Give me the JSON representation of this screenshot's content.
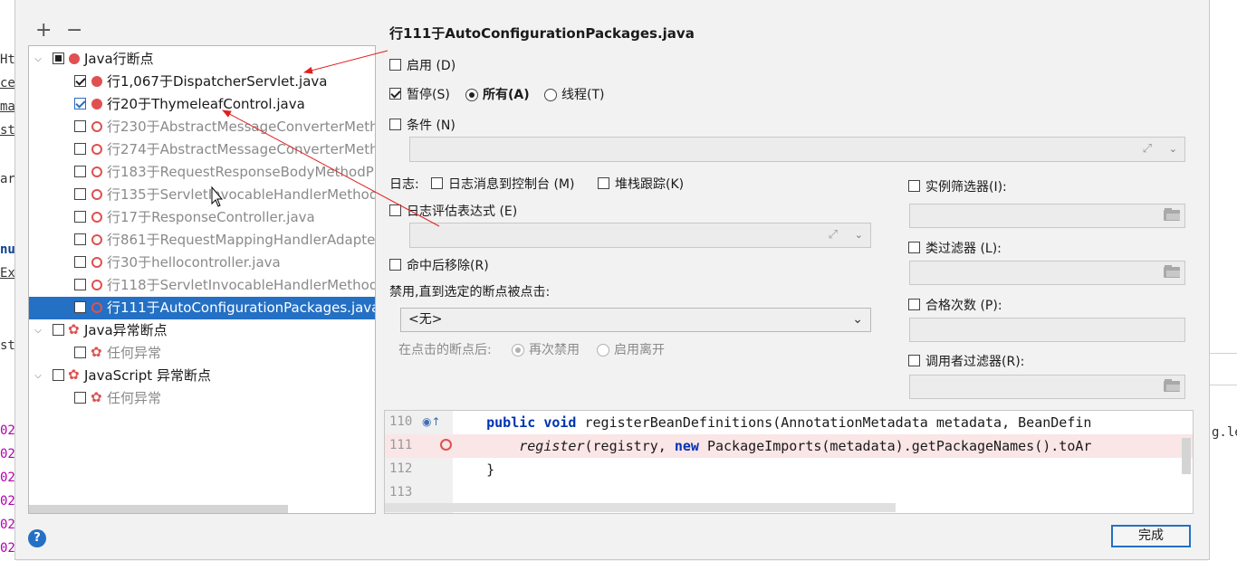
{
  "background": {
    "left_glyphs": [
      "Ht",
      "ce",
      "ma",
      "st",
      "ar",
      "nu",
      "Ex",
      "st",
      "02",
      "02",
      "02",
      "02",
      "02",
      "02",
      "02"
    ],
    "right_text": "g.le"
  },
  "toolbar": {
    "add_label": "+",
    "remove_label": "−"
  },
  "tree": {
    "groups": [
      {
        "label": "Java行断点",
        "items": [
          {
            "label": "行1,067于DispatcherServlet.java",
            "checked": true,
            "enabled": true
          },
          {
            "label": "行20于ThymeleafControl.java",
            "checked": true,
            "enabled": true
          },
          {
            "label": "行230于AbstractMessageConverterMeth",
            "checked": false,
            "enabled": false
          },
          {
            "label": "行274于AbstractMessageConverterMeth",
            "checked": false,
            "enabled": false
          },
          {
            "label": "行183于RequestResponseBodyMethodP",
            "checked": false,
            "enabled": false
          },
          {
            "label": "行135于ServletInvocableHandlerMethod",
            "checked": false,
            "enabled": false
          },
          {
            "label": "行17于ResponseController.java",
            "checked": false,
            "enabled": false
          },
          {
            "label": "行861于RequestMappingHandlerAdapte",
            "checked": false,
            "enabled": false
          },
          {
            "label": "行30于hellocontroller.java",
            "checked": false,
            "enabled": false
          },
          {
            "label": "行118于ServletInvocableHandlerMethod",
            "checked": false,
            "enabled": false
          },
          {
            "label": "行111于AutoConfigurationPackages.java",
            "checked": false,
            "enabled": false,
            "selected": true
          }
        ]
      },
      {
        "label": "Java异常断点",
        "items": [
          {
            "label": "任何异常"
          }
        ]
      },
      {
        "label": "JavaScript 异常断点",
        "items": [
          {
            "label": "任何异常"
          }
        ]
      }
    ]
  },
  "detail": {
    "title": "行111于AutoConfigurationPackages.java",
    "enabled_label": "启用 (D)",
    "suspend_label": "暂停(S)",
    "all_label": "所有(A)",
    "thread_label": "线程(T)",
    "condition_label": "条件 (N)",
    "log_label": "日志:",
    "log_message_label": "日志消息到控制台 (M)",
    "stack_trace_label": "堆栈跟踪(K)",
    "log_expr_label": "日志评估表达式 (E)",
    "remove_on_hit_label": "命中后移除(R)",
    "disable_until_label": "禁用,直到选定的断点被点击:",
    "disable_until_value": "<无>",
    "after_hit_label": "在点击的断点后:",
    "disable_again_label": "再次禁用",
    "leave_enabled_label": "启用离开",
    "instance_filter_label": "实例筛选器(I):",
    "class_filter_label": "类过滤器 (L):",
    "pass_count_label": "合格次数 (P):",
    "caller_filter_label": "调用者过滤器(R):"
  },
  "code": {
    "lines": [
      {
        "num": "110",
        "text": "    public void registerBeanDefinitions(AnnotationMetadata metadata, BeanDefin"
      },
      {
        "num": "111",
        "text": "        register(registry, new PackageImports(metadata).getPackageNames().toAr"
      },
      {
        "num": "112",
        "text": "    }"
      },
      {
        "num": "113",
        "text": ""
      }
    ]
  },
  "footer": {
    "help_label": "?",
    "done_label": "完成"
  },
  "colors": {
    "accent": "#2470c4",
    "breakpoint": "#e05050",
    "annotation_arrow": "#e02020"
  }
}
